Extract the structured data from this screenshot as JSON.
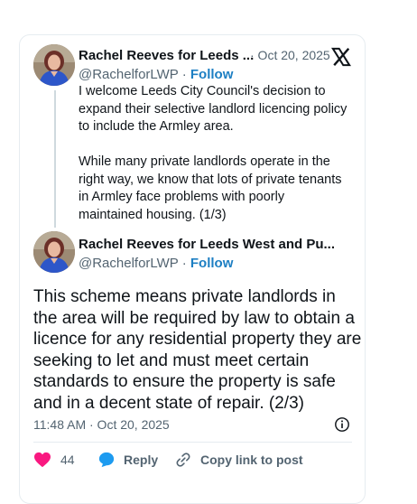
{
  "tweet1": {
    "author_name": "Rachel Reeves for Leeds ...",
    "handle": "@RachelforLWP",
    "separator": "·",
    "follow_label": "Follow",
    "date": "· Oct 20, 2025",
    "paragraph1": "I welcome Leeds City Council's decision to expand their selective landlord licencing policy to include the Armley area.",
    "paragraph2": "While many private landlords operate in the right way, we know that lots of private tenants in Armley face problems with poorly maintained housing. (1/3)"
  },
  "tweet2": {
    "author_name": "Rachel Reeves for Leeds West and Pu...",
    "handle": "@RachelforLWP",
    "separator": "·",
    "follow_label": "Follow",
    "text": "This scheme means private landlords in the area will be required by law to obtain a licence for any residential property they are seeking to let and must meet certain standards to ensure the property is safe and in a decent state of repair. (2/3)",
    "timestamp": "11:48 AM · Oct 20, 2025"
  },
  "actions": {
    "like_count": "44",
    "reply_label": "Reply",
    "copy_link_label": "Copy link to post"
  },
  "icons": {
    "platform_logo": "x-logo-icon",
    "info": "info-icon",
    "like": "heart-icon",
    "reply": "reply-bubble-icon",
    "copy_link": "link-icon"
  },
  "colors": {
    "follow_link": "#1d7fc3",
    "like_heart": "#f91880",
    "reply_bubble": "#1d9bf0",
    "secondary_text": "#536471"
  }
}
